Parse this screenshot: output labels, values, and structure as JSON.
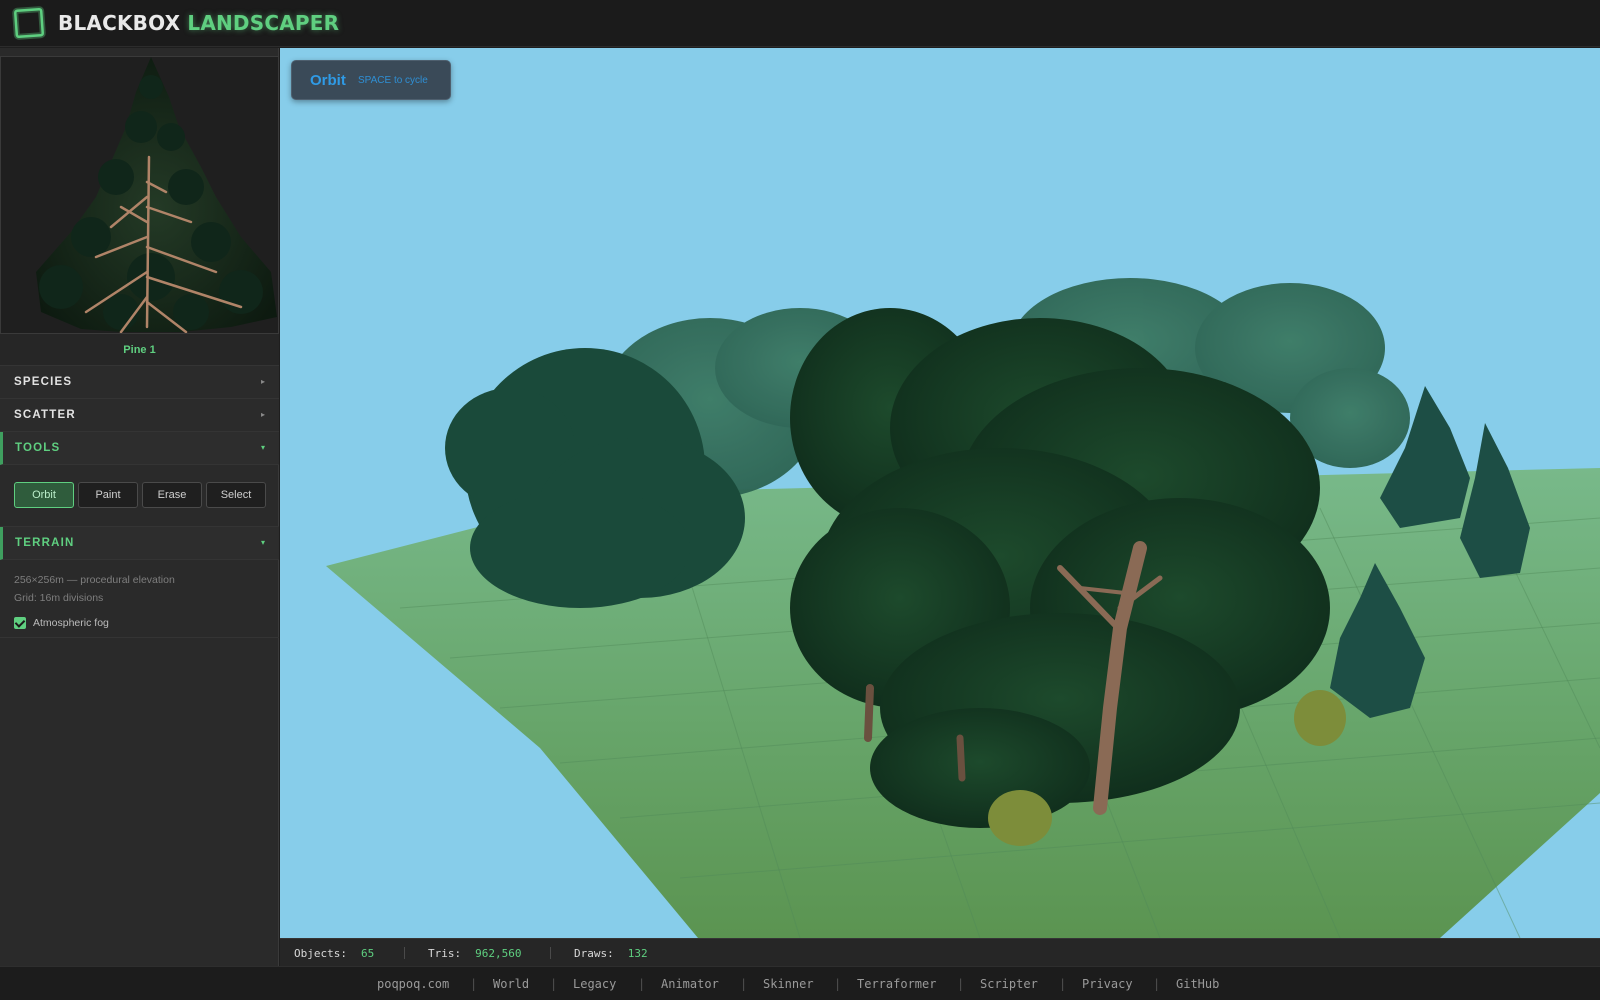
{
  "app": {
    "brand_part1": "BLACKBOX",
    "brand_part2": "LANDSCAPER",
    "accent_color": "#5fcf80"
  },
  "preview": {
    "name": "Pine 1"
  },
  "sections": {
    "species": "SPECIES",
    "scatter": "SCATTER",
    "tools": "TOOLS",
    "terrain": "TERRAIN",
    "collapsed_arrow": "▸",
    "expanded_arrow": "▾"
  },
  "tools": {
    "buttons": [
      "Orbit",
      "Paint",
      "Erase",
      "Select"
    ],
    "active": "Orbit"
  },
  "terrain": {
    "size_text": "256×256m — procedural elevation",
    "grid_text": "Grid: 16m divisions",
    "fog_label": "Atmospheric fog",
    "fog_checked": true
  },
  "viewport": {
    "mode": "Orbit",
    "mode_hint": "SPACE to cycle",
    "sky_color": "#87cdea"
  },
  "status": {
    "objects_label": "Objects:",
    "objects_value": "65",
    "tris_label": "Tris:",
    "tris_value": "962,560",
    "draws_label": "Draws:",
    "draws_value": "132"
  },
  "footer": {
    "links": [
      "poqpoq.com",
      "World",
      "Legacy",
      "Animator",
      "Skinner",
      "Terraformer",
      "Scripter",
      "Privacy",
      "GitHub"
    ],
    "separator": "|"
  }
}
